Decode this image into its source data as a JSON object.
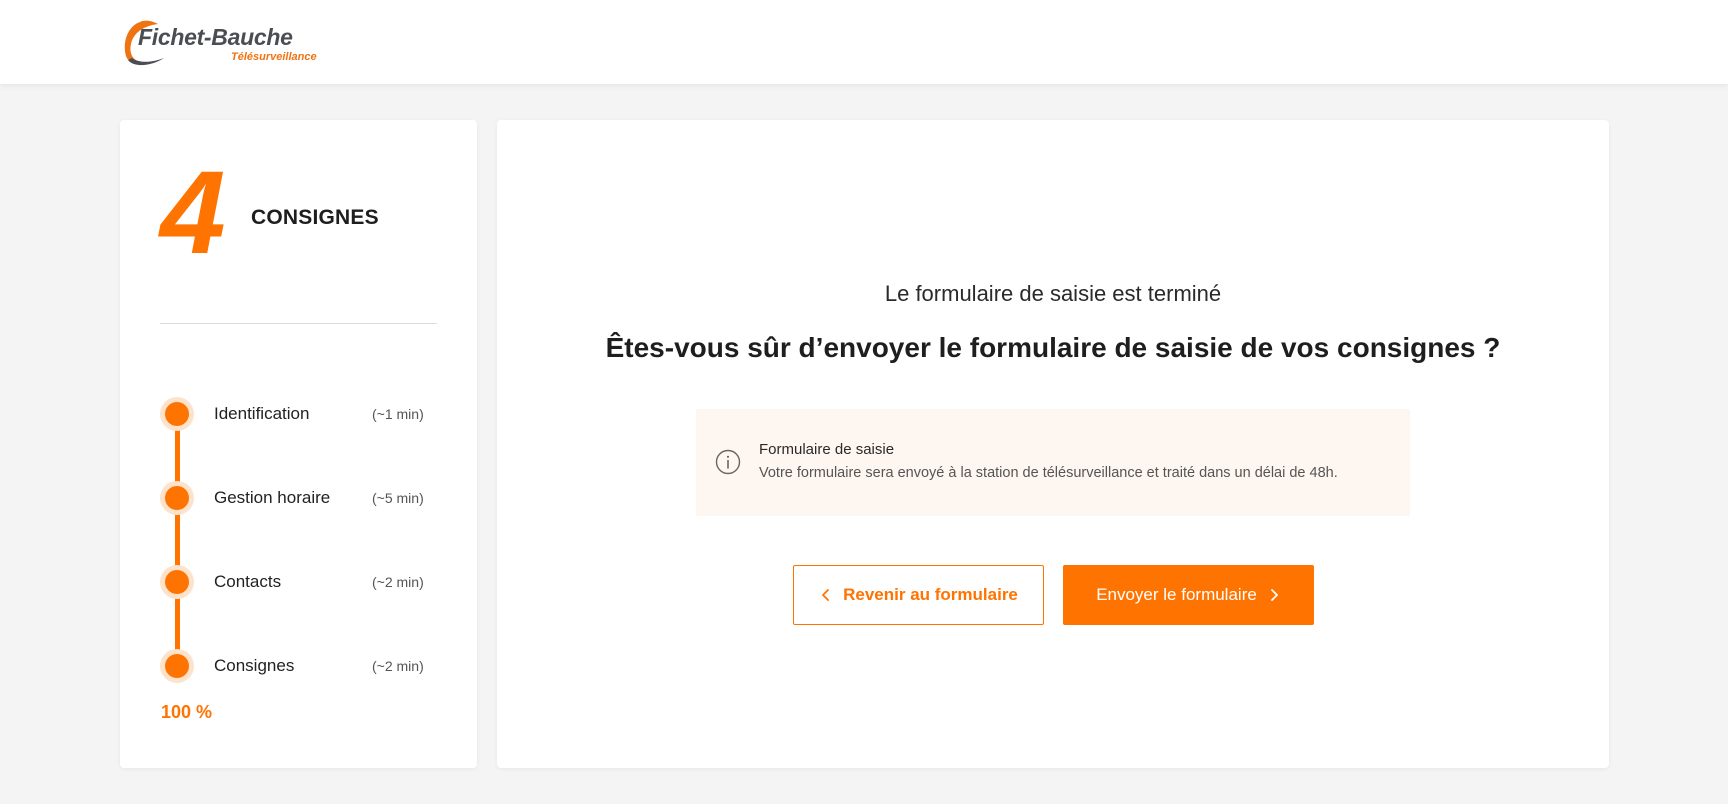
{
  "header": {
    "logo_main": "Fichet-Bauche",
    "logo_sub": "Télésurveillance",
    "logo_icon": "swoosh-logo"
  },
  "sidebar": {
    "step_number": "4",
    "step_title": "CONSIGNES",
    "steps": [
      {
        "label": "Identification",
        "time": "(~1 min)"
      },
      {
        "label": "Gestion horaire",
        "time": "(~5 min)"
      },
      {
        "label": "Contacts",
        "time": "(~2 min)"
      },
      {
        "label": "Consignes",
        "time": "(~2 min)"
      }
    ],
    "progress_label": "100 %",
    "progress_value": 100
  },
  "main": {
    "subtitle": "Le formulaire de saisie est terminé",
    "question": "Êtes-vous sûr d’envoyer le formulaire de saisie de vos consignes ?",
    "info": {
      "icon": "info-icon",
      "title": "Formulaire de saisie",
      "text": "Votre formulaire sera envoyé à la station de télésurveillance et traité dans un délai de 48h."
    },
    "buttons": {
      "back_label": "Revenir au formulaire",
      "send_label": "Envoyer le formulaire"
    }
  },
  "colors": {
    "accent": "#ff7300",
    "accent_light": "#fde2cc",
    "info_bg": "#fef6f1",
    "page_bg": "#f4f4f4"
  }
}
